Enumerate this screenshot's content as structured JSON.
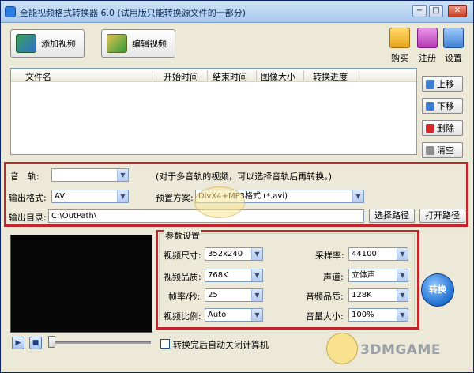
{
  "window": {
    "title": "全能视频格式转换器 6.0 (试用版只能转换源文件的一部分)",
    "minimize_glyph": "−",
    "maximize_glyph": "□",
    "close_glyph": "✕"
  },
  "toolbar": {
    "add_video": "添加视频",
    "edit_video": "编辑视频",
    "buy": "购买",
    "register": "注册",
    "settings": "设置"
  },
  "file_list": {
    "columns": [
      "文件名",
      "开始时间",
      "结束时间",
      "图像大小",
      "转换进度"
    ]
  },
  "side_buttons": {
    "move_up": "上移",
    "move_down": "下移",
    "delete": "删除",
    "clear": "清空"
  },
  "output": {
    "track_label": "音　轨:",
    "track_value": "",
    "track_hint": "(对于多音轨的视频，可以选择音轨后再转换。)",
    "format_label": "输出格式:",
    "format_value": "AVI",
    "preset_label": "预置方案:",
    "preset_value": "DivX4+MP3格式 (*.avi)",
    "dir_label": "输出目录:",
    "dir_value": "C:\\OutPath\\",
    "choose_path": "选择路径",
    "open_path": "打开路径"
  },
  "params": {
    "group_title": "参数设置",
    "video_size_label": "视频尺寸:",
    "video_size": "352x240",
    "video_quality_label": "视频品质:",
    "video_quality": "768K",
    "frame_rate_label": "帧率/秒:",
    "frame_rate": "25",
    "aspect_label": "视频比例:",
    "aspect": "Auto",
    "sample_rate_label": "采样率:",
    "sample_rate": "44100",
    "channels_label": "声道:",
    "channels": "立体声",
    "audio_quality_label": "音频品质:",
    "audio_quality": "128K",
    "volume_label": "音量大小:",
    "volume": "100%"
  },
  "convert_button": "转换",
  "shutdown_checkbox": "转换完后自动关闭计算机",
  "watermark": "3DMGAME",
  "dropdown_arrow": "▼",
  "colors": {
    "highlight_box": "#c0272d",
    "titlebar": "#a9c9ee",
    "window_bg": "#ece9d8"
  }
}
